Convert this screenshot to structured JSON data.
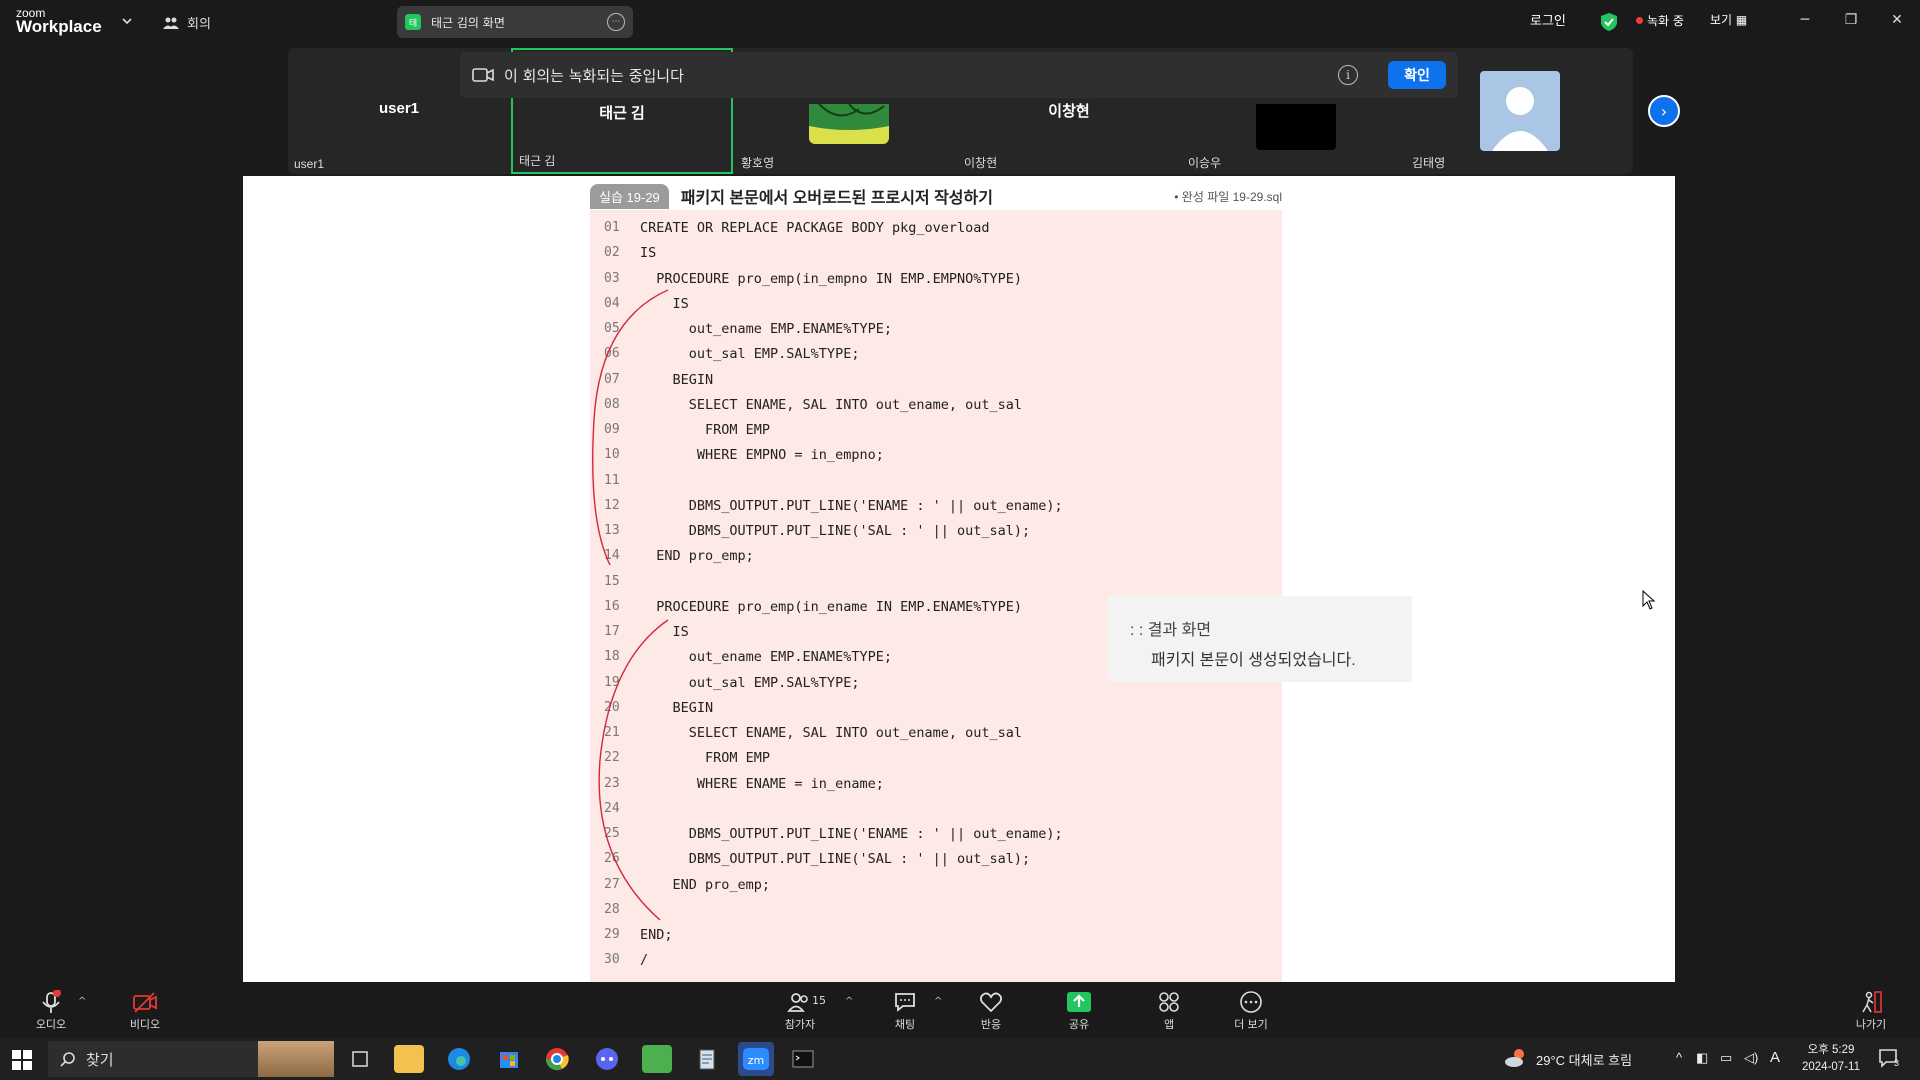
{
  "app": {
    "brand_small": "zoom",
    "brand": "Workplace",
    "meeting_label": "회의"
  },
  "share_pill": {
    "tag": "태",
    "label": "태근 김의 화면"
  },
  "top_right": {
    "signin": "로그인",
    "recording": "녹화 중",
    "view": "보기"
  },
  "recording_banner": {
    "text": "이 회의는 녹화되는 중입니다",
    "ok": "확인"
  },
  "participants": [
    {
      "center": "user1",
      "label": "user1"
    },
    {
      "center": "태근 김",
      "label": "태근 김"
    },
    {
      "center": "",
      "label": "황호영"
    },
    {
      "center": "이창현",
      "label": "이창현"
    },
    {
      "center": "",
      "label": "이승우"
    },
    {
      "center": "",
      "label": "김태영"
    }
  ],
  "book": {
    "tag": "실습 19-29",
    "title": "패키지 본문에서 오버로드된 프로시저 작성하기",
    "file": "• 완성 파일  19-29.sql",
    "lines": [
      {
        "n": "01",
        "t": "CREATE OR REPLACE PACKAGE BODY pkg_overload"
      },
      {
        "n": "02",
        "t": "IS"
      },
      {
        "n": "03",
        "t": "  PROCEDURE pro_emp(in_empno IN EMP.EMPNO%TYPE)"
      },
      {
        "n": "04",
        "t": "    IS"
      },
      {
        "n": "05",
        "t": "      out_ename EMP.ENAME%TYPE;"
      },
      {
        "n": "06",
        "t": "      out_sal EMP.SAL%TYPE;"
      },
      {
        "n": "07",
        "t": "    BEGIN"
      },
      {
        "n": "08",
        "t": "      SELECT ENAME, SAL INTO out_ename, out_sal"
      },
      {
        "n": "09",
        "t": "        FROM EMP"
      },
      {
        "n": "10",
        "t": "       WHERE EMPNO = in_empno;"
      },
      {
        "n": "11",
        "t": ""
      },
      {
        "n": "12",
        "t": "      DBMS_OUTPUT.PUT_LINE('ENAME : ' || out_ename);"
      },
      {
        "n": "13",
        "t": "      DBMS_OUTPUT.PUT_LINE('SAL : ' || out_sal);"
      },
      {
        "n": "14",
        "t": "  END pro_emp;"
      },
      {
        "n": "15",
        "t": ""
      },
      {
        "n": "16",
        "t": "  PROCEDURE pro_emp(in_ename IN EMP.ENAME%TYPE)"
      },
      {
        "n": "17",
        "t": "    IS"
      },
      {
        "n": "18",
        "t": "      out_ename EMP.ENAME%TYPE;"
      },
      {
        "n": "19",
        "t": "      out_sal EMP.SAL%TYPE;"
      },
      {
        "n": "20",
        "t": "    BEGIN"
      },
      {
        "n": "21",
        "t": "      SELECT ENAME, SAL INTO out_ename, out_sal"
      },
      {
        "n": "22",
        "t": "        FROM EMP"
      },
      {
        "n": "23",
        "t": "       WHERE ENAME = in_ename;"
      },
      {
        "n": "24",
        "t": ""
      },
      {
        "n": "25",
        "t": "      DBMS_OUTPUT.PUT_LINE('ENAME : ' || out_ename);"
      },
      {
        "n": "26",
        "t": "      DBMS_OUTPUT.PUT_LINE('SAL : ' || out_sal);"
      },
      {
        "n": "27",
        "t": "    END pro_emp;"
      },
      {
        "n": "28",
        "t": ""
      },
      {
        "n": "29",
        "t": "END;"
      },
      {
        "n": "30",
        "t": "/"
      }
    ],
    "result_title": ": : 결과 화면",
    "result_body": "패키지 본문이 생성되었습니다."
  },
  "controls": {
    "audio": "오디오",
    "video": "비디오",
    "participants": "참가자",
    "participant_count": "15",
    "chat": "채팅",
    "react": "반응",
    "share": "공유",
    "apps": "앱",
    "more": "더 보기",
    "leave": "나가기"
  },
  "taskbar": {
    "search": "찾기",
    "weather": "29°C  대체로 흐림",
    "ime": "A",
    "time": "오후 5:29",
    "date": "2024-07-11",
    "notif_count": "3"
  },
  "colors": {
    "accent": "#0e72ed",
    "active_border": "#22c55e",
    "code_bg": "#fde9e6",
    "record_red": "#f23d3d"
  }
}
